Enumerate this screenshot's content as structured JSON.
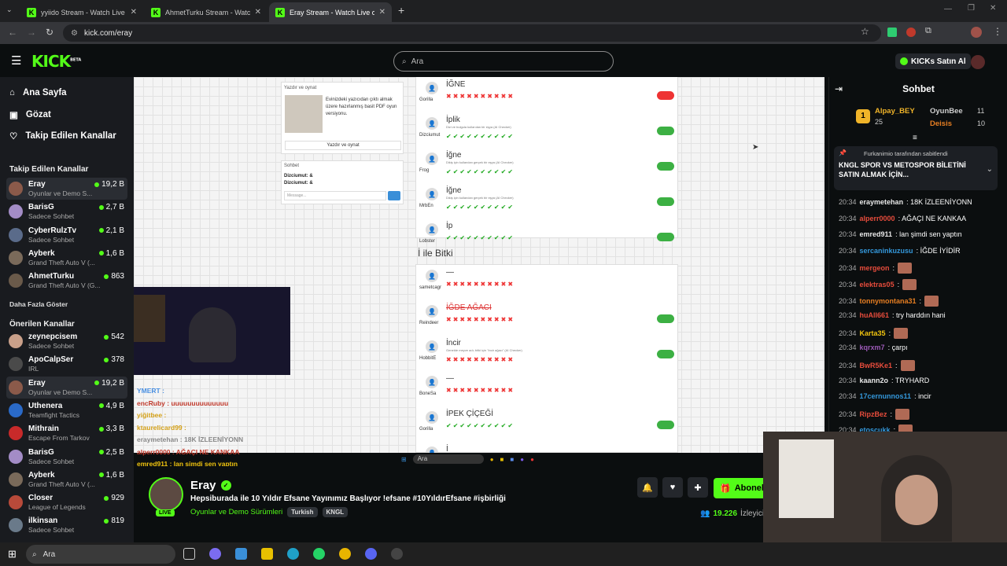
{
  "browser": {
    "tabs": [
      {
        "title": "yyiido Stream - Watch Live on K",
        "active": false
      },
      {
        "title": "AhmetTurku Stream - Watch Li",
        "active": false
      },
      {
        "title": "Eray Stream - Watch Live on Ki",
        "active": true
      }
    ],
    "url": "kick.com/eray"
  },
  "header": {
    "logo": "KICK",
    "logo_sup": "BETA",
    "search_placeholder": "Ara",
    "kicks_button": "KICKs Satın Al"
  },
  "sidebar": {
    "nav": [
      {
        "label": "Ana Sayfa",
        "icon": "home-icon"
      },
      {
        "label": "Gözat",
        "icon": "browse-icon"
      },
      {
        "label": "Takip Edilen Kanallar",
        "icon": "heart-icon"
      }
    ],
    "followed_title": "Takip Edilen Kanallar",
    "followed": [
      {
        "name": "Eray",
        "sub": "Oyunlar ve Demo S...",
        "viewers": "19,2 B",
        "color": "#8b5a4a"
      },
      {
        "name": "BarisG",
        "sub": "Sadece Sohbet",
        "viewers": "2,7 B",
        "color": "#a38cc6"
      },
      {
        "name": "CyberRulzTv",
        "sub": "Sadece Sohbet",
        "viewers": "2,1 B",
        "color": "#5a6b8a"
      },
      {
        "name": "Ayberk",
        "sub": "Grand Theft Auto V (...",
        "viewers": "1,6 B",
        "color": "#7a6a5a"
      },
      {
        "name": "AhmetTurku",
        "sub": "Grand Theft Auto V (G...",
        "viewers": "863",
        "color": "#6a5a4a"
      }
    ],
    "show_more": "Daha Fazla Göster",
    "recommended_title": "Önerilen Kanallar",
    "recommended": [
      {
        "name": "zeynepcisem",
        "sub": "Sadece Sohbet",
        "viewers": "542",
        "color": "#c9a08a"
      },
      {
        "name": "ApoCalpSer",
        "sub": "IRL",
        "viewers": "378",
        "color": "#4a4a4a"
      },
      {
        "name": "Eray",
        "sub": "Oyunlar ve Demo S...",
        "viewers": "19,2 B",
        "color": "#8b5a4a"
      },
      {
        "name": "Uthenera",
        "sub": "Teamfight Tactics",
        "viewers": "4,9 B",
        "color": "#2a6ac8"
      },
      {
        "name": "Mithrain",
        "sub": "Escape From Tarkov",
        "viewers": "3,3 B",
        "color": "#c82a2a"
      },
      {
        "name": "BarisG",
        "sub": "Sadece Sohbet",
        "viewers": "2,5 B",
        "color": "#a38cc6"
      },
      {
        "name": "Ayberk",
        "sub": "Grand Theft Auto V (...",
        "viewers": "1,6 B",
        "color": "#7a6a5a"
      },
      {
        "name": "Closer",
        "sub": "League of Legends",
        "viewers": "929",
        "color": "#b84a3a"
      },
      {
        "name": "ilkinsan",
        "sub": "Sadece Sohbet",
        "viewers": "819",
        "color": "#6a7a8a"
      }
    ]
  },
  "stream": {
    "print_card": {
      "title": "Yazdır ve oynat",
      "desc": "Evinizdeki yazıcıdan çıktı almak üzere hazırlanmış basit PDF oyun versiyonu.",
      "button": "Yazdır ve oynat"
    },
    "chat_card": {
      "title": "Sohbet",
      "lines": [
        "Dizciumut: &",
        "Dizciumut: &"
      ],
      "placeholder": "Message..."
    },
    "words_top": [
      {
        "user": "Gorilla",
        "word": "İĞNE",
        "state": "bad",
        "toggle": "off",
        "note": ""
      },
      {
        "user": "Dizciumut",
        "word": "İplik",
        "state": "ok",
        "toggle": "on",
        "note": "Dizi ve bulgula kullanılan bir eşya (AI Checker)"
      },
      {
        "user": "Frog",
        "word": "İğne",
        "state": "ok",
        "toggle": "on",
        "note": "Dikiş için kullanılan gerçek bir eşya (AI Checker)"
      },
      {
        "user": "MrbEn",
        "word": "İğne",
        "state": "ok",
        "toggle": "on",
        "note": "Dikiş için kullanılan gerçek bir eşya (AI Checker)"
      },
      {
        "user": "Lobster",
        "word": "İp",
        "state": "ok",
        "toggle": "on",
        "note": ""
      }
    ],
    "section_title": "İ ile Bitki",
    "words_bottom": [
      {
        "user": "sametcagr",
        "word": "—",
        "state": "bad",
        "toggle": "",
        "note": ""
      },
      {
        "user": "Reindeer",
        "word": "İĞDE AĞACI",
        "state": "bad",
        "toggle": "on",
        "note": "",
        "strike": true
      },
      {
        "user": "HobbitE",
        "word": "İncir",
        "state": "bad",
        "toggle": "on",
        "note": "Genelde meyve adı; bitki için \"incir ağacı\" (AI Checker)"
      },
      {
        "user": "BoneSa",
        "word": "—",
        "state": "bad",
        "toggle": "",
        "note": ""
      },
      {
        "user": "Gorilla",
        "word": "İPEK ÇİÇEĞİ",
        "state": "ok",
        "toggle": "on",
        "note": ""
      },
      {
        "user": "Dizciumut",
        "word": "İ",
        "state": "bad",
        "toggle": "off",
        "note": ""
      }
    ],
    "overlay_chat": [
      {
        "text": "YMERT :",
        "color": "#4a90e2"
      },
      {
        "text": "encRuby : uuuuuuuuuuuuuu",
        "color": "#c0392b"
      },
      {
        "text": "yiğitbee :",
        "color": "#d4a017"
      },
      {
        "text": "ktaurelicard99 :",
        "color": "#d4a017"
      },
      {
        "text": "eraymetehan : 18K İZLEENİYONN",
        "color": "#888"
      },
      {
        "text": "alperr0000 : AĞAÇI NE KANKAA",
        "color": "#c0392b"
      },
      {
        "text": "emred911 : lan şimdi sen yaptın",
        "color": "#f1c40f"
      }
    ],
    "taskbar_mini_search": "Ara"
  },
  "info": {
    "name": "Eray",
    "live_badge": "LIVE",
    "title": "Hepsiburada ile 10 Yıldır Efsane Yayınımız Başlıyor !efsane #10YıldırEfsane #işbirliği",
    "category": "Oyunlar ve Demo Sürümleri",
    "tags": [
      "Turkish",
      "KNGL"
    ],
    "follow_label": "Abonel",
    "viewers": "19.226",
    "viewers_label": "İzleyici"
  },
  "chat": {
    "title": "Sohbet",
    "leaderboard": [
      {
        "name": "Alpay_BEY",
        "count": "25",
        "color": "#f0b429"
      },
      {
        "name": "OyunBee",
        "count": "11",
        "color": "#cfcfcf"
      },
      {
        "name": "Deisis",
        "count": "10",
        "color": "#e67e22"
      }
    ],
    "pinned_by": "Furkanimio tarafından sabitlendi",
    "pinned_text": "KNGL SPOR VS METOSPOR BİLETİNİ SATIN ALMAK İÇİN...",
    "messages": [
      {
        "time": "20:34",
        "user": "eraymetehan",
        "color": "#e8e8e8",
        "text": ": 18K İZLEENİYONN",
        "emote": false
      },
      {
        "time": "20:34",
        "user": "alperr0000",
        "color": "#e74c3c",
        "text": ": AĞAÇI NE KANKAA",
        "emote": false
      },
      {
        "time": "20:34",
        "user": "emred911",
        "color": "#e8e8e8",
        "text": ": lan şimdi sen yaptın",
        "emote": false
      },
      {
        "time": "20:34",
        "user": "sercaninkuzusu",
        "color": "#3498db",
        "text": ": İĞDE İYİDİR",
        "emote": false
      },
      {
        "time": "20:34",
        "user": "mergeon",
        "color": "#e74c3c",
        "text": ":",
        "emote": true
      },
      {
        "time": "20:34",
        "user": "elektras05",
        "color": "#e74c3c",
        "text": ":",
        "emote": true
      },
      {
        "time": "20:34",
        "user": "tonnymontana31",
        "color": "#e67e22",
        "text": ":",
        "emote": true
      },
      {
        "time": "20:34",
        "user": "huAll661",
        "color": "#e74c3c",
        "text": ": try harddın hani",
        "emote": false
      },
      {
        "time": "20:34",
        "user": "Karta35",
        "color": "#f1c40f",
        "text": ":",
        "emote": true
      },
      {
        "time": "20:34",
        "user": "kqrxm7",
        "color": "#9b59b6",
        "text": ": çarpı",
        "emote": false
      },
      {
        "time": "20:34",
        "user": "BwR5Ke1",
        "color": "#e74c3c",
        "text": ":",
        "emote": true
      },
      {
        "time": "20:34",
        "user": "kaann2o",
        "color": "#e8e8e8",
        "text": ": TRYHARD",
        "emote": false
      },
      {
        "time": "20:34",
        "user": "17cernunnos11",
        "color": "#3498db",
        "text": ": incir",
        "emote": false
      },
      {
        "time": "20:34",
        "user": "RipzBez",
        "color": "#e74c3c",
        "text": ":",
        "emote": true
      },
      {
        "time": "20:34",
        "user": "etoscukk",
        "color": "#3498db",
        "text": ":",
        "emote": true
      }
    ]
  },
  "taskbar": {
    "search": "Ara"
  },
  "colors": {
    "accent": "#53fc18",
    "background": "#0b0e0f",
    "sidebar": "#191b1f"
  }
}
